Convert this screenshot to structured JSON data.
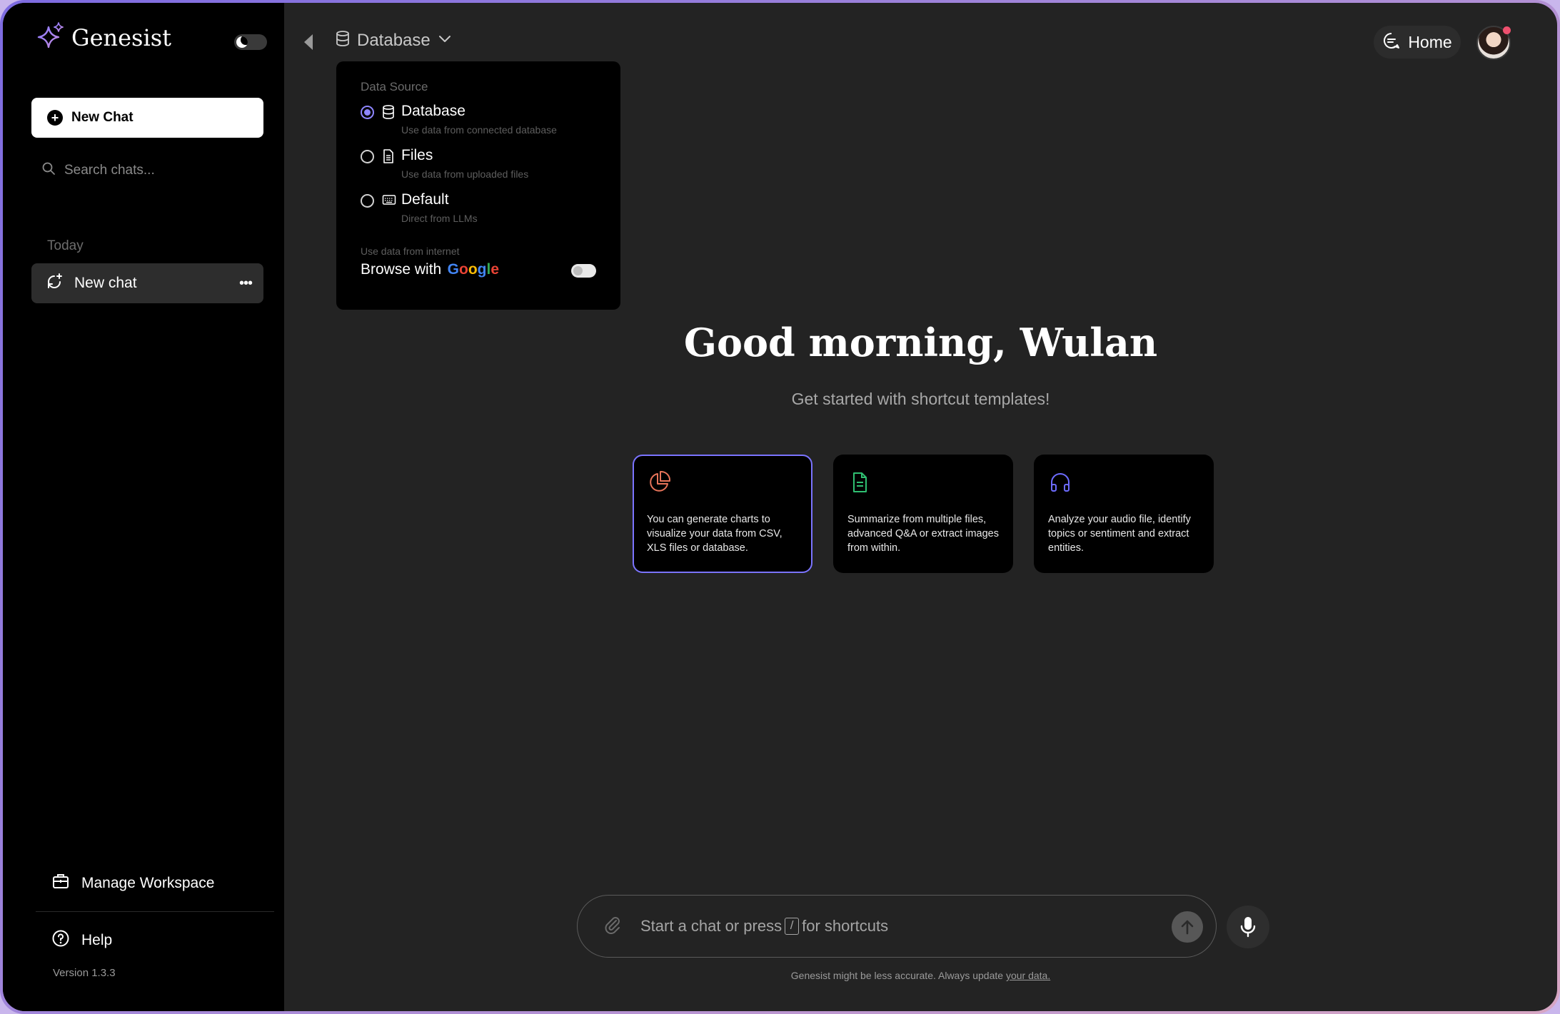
{
  "app": {
    "name": "Genesist"
  },
  "sidebar": {
    "new_chat_label": "New Chat",
    "search_placeholder": "Search chats...",
    "section_today": "Today",
    "chats": [
      {
        "label": "New chat"
      }
    ],
    "manage_workspace": "Manage Workspace",
    "help": "Help",
    "version": "Version 1.3.3"
  },
  "header": {
    "data_source_label": "Database",
    "home_label": "Home"
  },
  "data_source_menu": {
    "title": "Data Source",
    "options": [
      {
        "label": "Database",
        "description": "Use data from connected database",
        "selected": true,
        "icon": "database-icon"
      },
      {
        "label": "Files",
        "description": "Use data from uploaded files",
        "selected": false,
        "icon": "file-icon"
      },
      {
        "label": "Default",
        "description": "Direct from LLMs",
        "selected": false,
        "icon": "keyboard-icon"
      }
    ],
    "internet_caption": "Use data from internet",
    "browse_label": "Browse with",
    "browse_brand": "Google",
    "browse_enabled": false
  },
  "main": {
    "greeting": "Good morning, Wulan",
    "subtitle": "Get started with shortcut templates!",
    "templates": [
      {
        "text": "You can generate charts to visualize your data from CSV, XLS files or database.",
        "icon": "pie-chart-icon",
        "color": "#e8745a"
      },
      {
        "text": "Summarize from multiple files, advanced Q&A or extract images from within.",
        "icon": "document-icon",
        "color": "#2fbf71"
      },
      {
        "text": "Analyze your audio file, identify topics or sentiment and extract entities.",
        "icon": "headphones-icon",
        "color": "#6d6cff"
      }
    ]
  },
  "composer": {
    "placeholder_before": "Start a chat or press",
    "shortcut_key": "/",
    "placeholder_after": "for shortcuts"
  },
  "footer": {
    "disclaimer": "Genesist might be less accurate. Always update",
    "link": "your data."
  },
  "colors": {
    "accent": "#7b74ff",
    "sidebar_bg": "#000000",
    "main_bg": "#232323"
  }
}
